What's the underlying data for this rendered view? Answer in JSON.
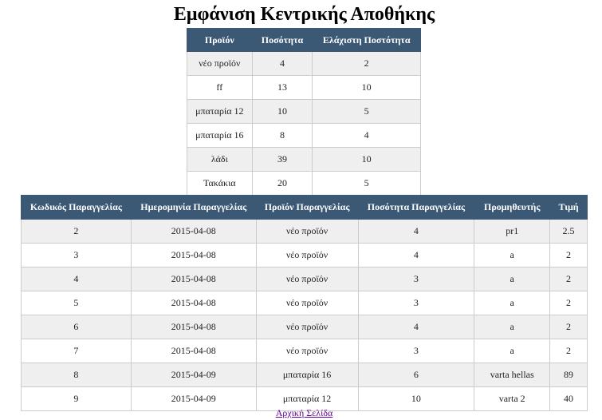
{
  "page": {
    "title": "Εμφάνιση Κεντρικής Αποθήκης"
  },
  "stock_table": {
    "headers": [
      "Προϊόν",
      "Ποσότητα",
      "Ελάχιστη Ποστότητα"
    ],
    "rows": [
      [
        "νέο προϊόν",
        "4",
        "2"
      ],
      [
        "ff",
        "13",
        "10"
      ],
      [
        "μπαταρία 12",
        "10",
        "5"
      ],
      [
        "μπαταρία 16",
        "8",
        "4"
      ],
      [
        "λάδι",
        "39",
        "10"
      ],
      [
        "Τακάκια",
        "20",
        "5"
      ]
    ]
  },
  "orders_table": {
    "headers": [
      "Κωδικός Παραγγελίας",
      "Ημερομηνία Παραγγελίας",
      "Προϊόν Παραγγελίας",
      "Ποσότητα Παραγγελίας",
      "Προμηθευτής",
      "Τιμή"
    ],
    "rows": [
      [
        "2",
        "2015-04-08",
        "νέο προϊόν",
        "4",
        "pr1",
        "2.5"
      ],
      [
        "3",
        "2015-04-08",
        "νέο προϊόν",
        "4",
        "a",
        "2"
      ],
      [
        "4",
        "2015-04-08",
        "νέο προϊόν",
        "3",
        "a",
        "2"
      ],
      [
        "5",
        "2015-04-08",
        "νέο προϊόν",
        "3",
        "a",
        "2"
      ],
      [
        "6",
        "2015-04-08",
        "νέο προϊόν",
        "4",
        "a",
        "2"
      ],
      [
        "7",
        "2015-04-08",
        "νέο προϊόν",
        "3",
        "a",
        "2"
      ],
      [
        "8",
        "2015-04-09",
        "μπαταρία 16",
        "6",
        "varta hellas",
        "89"
      ],
      [
        "9",
        "2015-04-09",
        "μπαταρία 12",
        "10",
        "varta 2",
        "40"
      ]
    ]
  },
  "footer": {
    "home_link_label": "Αρχική Σελίδα"
  }
}
